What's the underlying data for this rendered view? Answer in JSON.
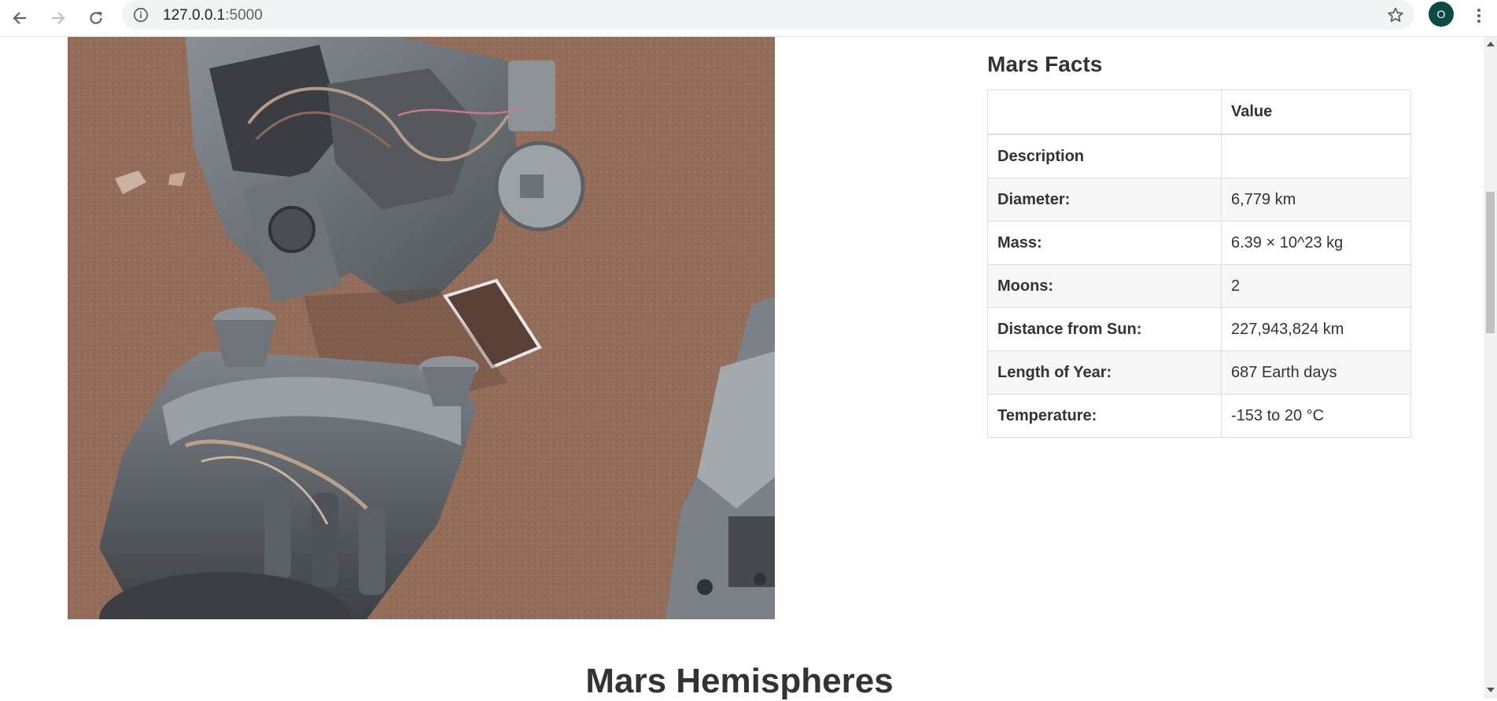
{
  "browser": {
    "url_host": "127.0.0.1",
    "url_port": ":5000",
    "profile_initial": "O",
    "accent_color": "#0b4b43"
  },
  "icons": {
    "back": "back-arrow-icon",
    "forward": "forward-arrow-icon",
    "reload": "reload-icon",
    "info": "info-icon",
    "bookmark": "star-icon",
    "menu": "kebab-menu-icon"
  },
  "facts": {
    "title": "Mars Facts",
    "header": [
      "",
      "Value"
    ],
    "rows": [
      {
        "label": "Description",
        "value": ""
      },
      {
        "label": "Diameter:",
        "value": "6,779 km"
      },
      {
        "label": "Mass:",
        "value": "6.39 × 10^23 kg"
      },
      {
        "label": "Moons:",
        "value": "2"
      },
      {
        "label": "Distance from Sun:",
        "value": "227,943,824 km"
      },
      {
        "label": "Length of Year:",
        "value": "687 Earth days"
      },
      {
        "label": "Temperature:",
        "value": "-153 to 20 °C"
      }
    ]
  },
  "hemispheres": {
    "title": "Mars Hemispheres"
  }
}
